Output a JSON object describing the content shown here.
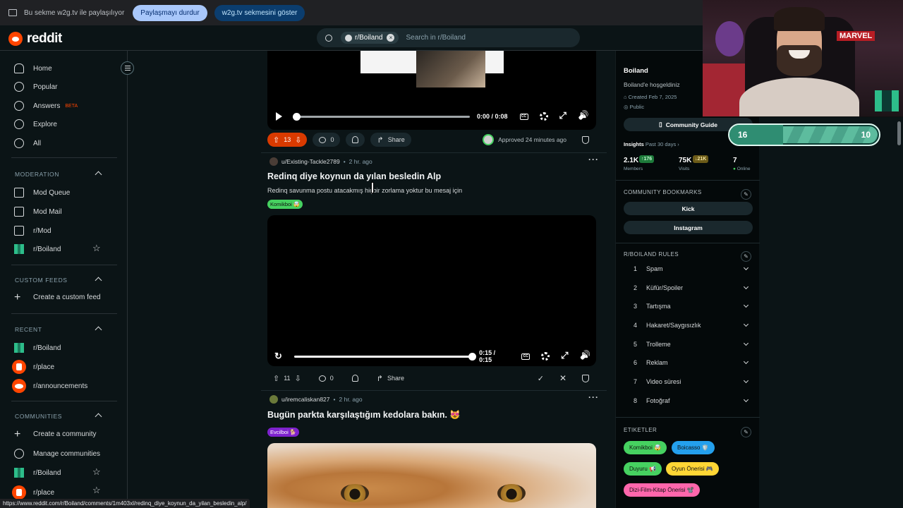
{
  "share_bar": {
    "text": "Bu sekme w2g.tv ile paylaşılıyor",
    "stop_label": "Paylaşmayı durdur",
    "show_label": "w2g.tv sekmesini göster"
  },
  "header": {
    "logo_text": "reddit",
    "search_chip": "r/Boiland",
    "search_placeholder": "Search in r/Boiland"
  },
  "sidebar": {
    "nav": [
      {
        "label": "Home",
        "icon": "home-icon"
      },
      {
        "label": "Popular",
        "icon": "popular-icon"
      },
      {
        "label": "Answers",
        "icon": "answers-icon",
        "badge": "BETA"
      },
      {
        "label": "Explore",
        "icon": "explore-icon"
      },
      {
        "label": "All",
        "icon": "all-icon"
      }
    ],
    "moderation": {
      "heading": "MODERATION",
      "items": [
        "Mod Queue",
        "Mod Mail",
        "r/Mod",
        "r/Boiland"
      ]
    },
    "custom_feeds": {
      "heading": "CUSTOM FEEDS",
      "items": [
        "Create a custom feed"
      ]
    },
    "recent": {
      "heading": "RECENT",
      "items": [
        "r/Boiland",
        "r/place",
        "r/announcements"
      ]
    },
    "communities": {
      "heading": "COMMUNITIES",
      "items": [
        "Create a community",
        "Manage communities",
        "r/Boiland",
        "r/place"
      ]
    }
  },
  "posts": [
    {
      "video_time": "0:00 / 0:08",
      "votes": "13",
      "comments": "0",
      "share_label": "Share",
      "approved_text": "Approved 24 minutes ago"
    },
    {
      "author": "u/Existing-Tackle2789",
      "time": "2 hr. ago",
      "title": "Redinq diye koynun da yılan besledin Alp",
      "body": "Redinq savunma postu atacakmış hiçbir zorlama yoktur bu mesaj için",
      "flair": "Komikboi 🤯",
      "video_time": "0:15 / 0:15",
      "video_progress": 1.0,
      "votes": "11",
      "comments": "0",
      "share_label": "Share"
    },
    {
      "author": "u/iremcaliskan827",
      "time": "2 hr. ago",
      "title": "Bugün parkta karşılaştığım kedolara bakın. 😻",
      "flair": "Evcilboi 🐕"
    }
  ],
  "right": {
    "name": "Boiland",
    "description": "Boiland'e hoşgeldiniz",
    "created": "Created Feb 7, 2025",
    "visibility": "Public",
    "guide_label": "Community Guide",
    "insights_label": "Insights",
    "insights_period": "Past 30 days ›",
    "members_value": "2.1K",
    "members_change": "↑176",
    "members_label": "Members",
    "visits_value": "75K",
    "visits_change": "↓21K",
    "visits_label": "Visits",
    "online_value": "7",
    "online_label": "Online",
    "bookmarks_heading": "COMMUNITY BOOKMARKS",
    "bookmarks": [
      "Kick",
      "Instagram"
    ],
    "rules_heading": "R/BOILAND RULES",
    "rules": [
      {
        "n": "1",
        "t": "Spam"
      },
      {
        "n": "2",
        "t": "Küfür/Spoiler"
      },
      {
        "n": "3",
        "t": "Tartışma"
      },
      {
        "n": "4",
        "t": "Hakaret/Saygısızlık"
      },
      {
        "n": "5",
        "t": "Trolleme"
      },
      {
        "n": "6",
        "t": "Reklam"
      },
      {
        "n": "7",
        "t": "Video süresi"
      },
      {
        "n": "8",
        "t": "Fotoğraf"
      }
    ],
    "tags_heading": "ETIKETLER",
    "tags": [
      {
        "label": "Komikboi 🤯",
        "color": "#46d160"
      },
      {
        "label": "Boicasso 🛡️",
        "color": "#24a0ed"
      },
      {
        "label": "Duyuru 📢",
        "color": "#46d160"
      },
      {
        "label": "Oyun Önerisi 🎮",
        "color": "#ffd635"
      },
      {
        "label": "Dizi-Film-Kitap Önerisi 📽️",
        "color": "#ff66ac"
      }
    ]
  },
  "overlay": {
    "goal_current": "16",
    "goal_target": "10",
    "webcam_poster": "MARVEL"
  },
  "status_url": "https://www.reddit.com/r/Boiland/comments/1m403xl/redinq_diye_koynun_da_yilan_besledin_alp/",
  "colors": {
    "accent": "#ff4500",
    "upvote_active": "#d93a00",
    "flair_komikboi": "#46d160",
    "flair_evcilboi": "#7e22ce"
  }
}
